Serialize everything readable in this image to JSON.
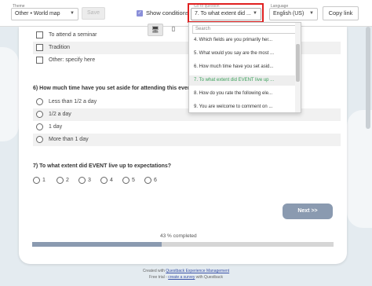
{
  "toolbar": {
    "theme_label": "Theme",
    "theme_value": "Other • World map",
    "save_label": "Save",
    "show_conditions_label": "Show conditions",
    "go_to_question_label": "Go to question",
    "go_to_question_value": "7. To what extent did ...",
    "language_label": "Language",
    "language_value": "English (US)",
    "copy_link_label": "Copy link"
  },
  "device": {
    "desktop_icon": "desktop-icon",
    "tablet_icon": "tablet-icon"
  },
  "question_prev": {
    "options": [
      "To attend a seminar",
      "Tradition",
      "Other: specify here"
    ]
  },
  "question6": {
    "title": "6) How much time have you set aside for attending this event?",
    "options": [
      "Less than 1/2 a day",
      "1/2 a day",
      "1 day",
      "More than 1 day"
    ]
  },
  "question7": {
    "title": "7) To what extent did EVENT live up to expectations?",
    "scale": [
      "1",
      "2",
      "3",
      "4",
      "5",
      "6"
    ]
  },
  "next_label": "Next >>",
  "progress": {
    "label": "43 % completed",
    "value": 43
  },
  "footer": {
    "line1_prefix": "Created with ",
    "line1_link": "Questback Experience Management",
    "line2_prefix": "Free trial - ",
    "line2_link": "create a survey",
    "line2_suffix": " with Questback"
  },
  "dropdown": {
    "search_placeholder": "Search",
    "items": [
      "4. Which fields are you primarily her...",
      "5. What would you say are the most ...",
      "6. How much time have you set asid...",
      "7. To what extent did EVENT live up ...",
      "8. How do you rate the following ele...",
      "9. You are welcome to comment on ..."
    ],
    "selected_index": 3
  },
  "colors": {
    "accent": "#8a9ab0",
    "checkbox_checked": "#8a8fd9",
    "highlight_frame": "#e02020",
    "selected_item_text": "#3aa05a"
  }
}
